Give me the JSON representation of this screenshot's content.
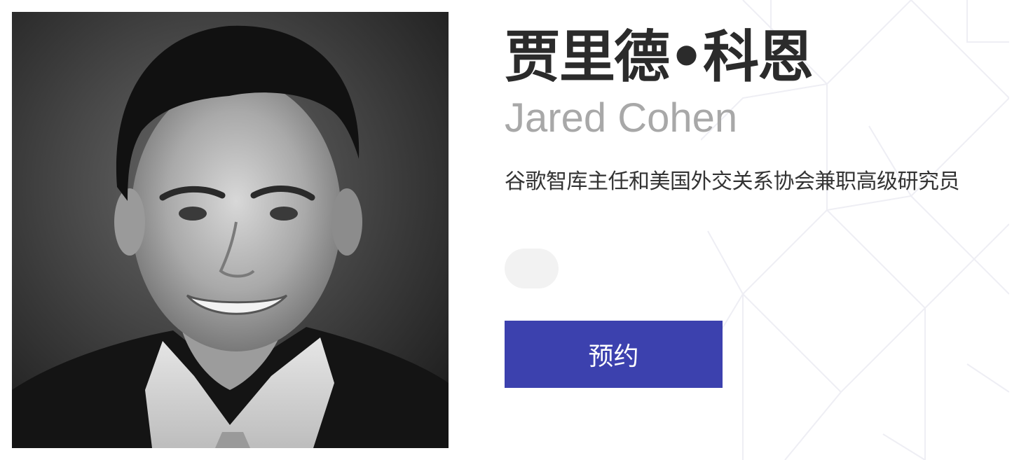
{
  "speaker": {
    "name_cn": "贾里德•科恩",
    "name_en": "Jared Cohen",
    "title": "谷歌智库主任和美国外交关系协会兼职高级研究员",
    "photo": "portrait-photo"
  },
  "tag": {
    "label": ""
  },
  "actions": {
    "book_label": "预约"
  },
  "colors": {
    "button_bg": "#3c41ae",
    "name_cn": "#2b2b2b",
    "name_en": "#a8a8a8"
  }
}
